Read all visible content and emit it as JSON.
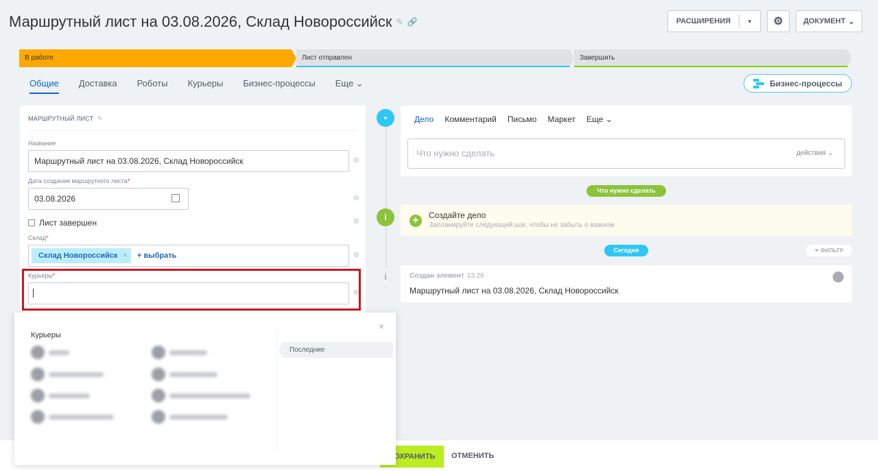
{
  "header": {
    "title": "Маршрутный лист на 03.08.2026, Склад Новороссийск",
    "extensions_label": "РАСШИРЕНИЯ",
    "document_label": "ДОКУМЕНТ"
  },
  "stages": [
    {
      "label": "В работе",
      "color": "#ffa900"
    },
    {
      "label": "Лист отправлен",
      "color": "#2fc6f6"
    },
    {
      "label": "Завершить",
      "color": "#7bd500"
    }
  ],
  "tabs": [
    "Общие",
    "Доставка",
    "Роботы",
    "Курьеры",
    "Бизнес-процессы",
    "Еще"
  ],
  "business_process_button": "Бизнес-процессы",
  "form": {
    "section_title": "МАРШРУТНЫЙ ЛИСТ",
    "name_label": "Название",
    "name_value": "Маршрутный лист на 03.08.2026, Склад Новороссийск",
    "date_label": "Дата создания маршрутного листа",
    "date_value": "03.08.2026",
    "completed_label": "Лист завершен",
    "warehouse_label": "Склад",
    "warehouse_tag": "Склад Новороссийск",
    "pick_label": "+ выбрать",
    "couriers_label": "Курьеры",
    "required_mark": "*"
  },
  "popup": {
    "title": "Курьеры",
    "recent_tab": "Последние",
    "close_symbol": "×"
  },
  "footer": {
    "save": "СОХРАНИТЬ",
    "cancel": "ОТМЕНИТЬ"
  },
  "activity": {
    "tabs": [
      "Дело",
      "Комментарий",
      "Письмо",
      "Маркет",
      "Еще"
    ],
    "input_placeholder": "Что нужно сделать",
    "actions_label": "действия",
    "todo_pill": "Что нужно сделать",
    "create_title": "Создайте дело",
    "create_subtitle": "Запланируйте следующий шаг, чтобы не забыть о важном",
    "today_pill": "Сегодня",
    "filter_label": "ФИЛЬТР",
    "event_title": "Создан элемент",
    "event_time": "13:26",
    "event_body": "Маршрутный лист на 03.08.2026, Склад Новороссийск"
  },
  "colors": {
    "accent_blue": "#2fc6f6",
    "green": "#8dc33b",
    "save_green": "#bbed21",
    "highlight_red": "#d0151b"
  }
}
